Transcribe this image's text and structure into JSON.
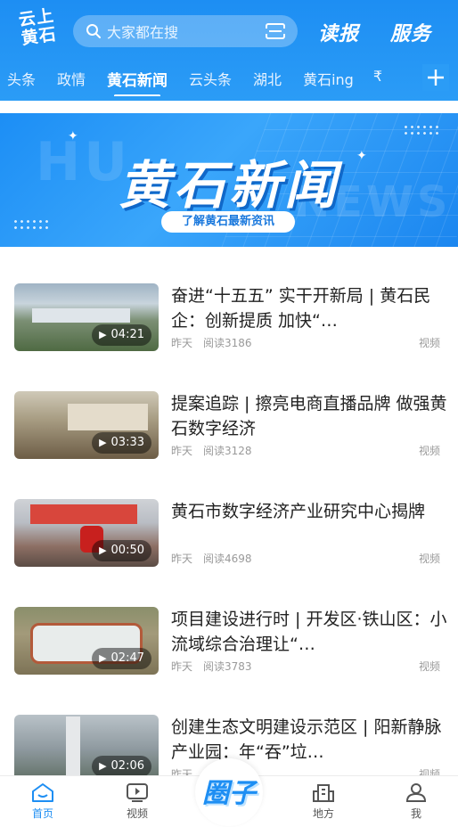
{
  "header": {
    "logo_text": "云上黄石",
    "search_placeholder": "大家都在搜",
    "link_read": "读报",
    "link_service": "服务"
  },
  "tabs": [
    {
      "label": "头条"
    },
    {
      "label": "政情"
    },
    {
      "label": "黄石新闻"
    },
    {
      "label": "云头条"
    },
    {
      "label": "湖北"
    },
    {
      "label": "黄石ing"
    },
    {
      "label": "₹"
    }
  ],
  "banner": {
    "title": "黄石新闻",
    "ghost_left": "HU",
    "ghost_right": "NEWS",
    "pill": "了解黄石最新资讯"
  },
  "news": [
    {
      "title": "奋进“十五五” 实干开新局 | 黄石民企：创新提质 加快“…",
      "duration": "04:21",
      "time": "昨天",
      "reads": "阅读3186",
      "type": "视频"
    },
    {
      "title": "提案追踪 | 擦亮电商直播品牌 做强黄石数字经济",
      "duration": "03:33",
      "time": "昨天",
      "reads": "阅读3128",
      "type": "视频"
    },
    {
      "title": "黄石市数字经济产业研究中心揭牌",
      "duration": "00:50",
      "time": "昨天",
      "reads": "阅读4698",
      "type": "视频"
    },
    {
      "title": "项目建设进行时 | 开发区·铁山区：小流域综合治理让“…",
      "duration": "02:47",
      "time": "昨天",
      "reads": "阅读3783",
      "type": "视频"
    },
    {
      "title": "创建生态文明建设示范区 | 阳新静脉产业园：年“吞”垃…",
      "duration": "02:06",
      "time": "昨天",
      "reads": "",
      "type": "视频"
    }
  ],
  "bottom_nav": {
    "home": "首页",
    "video": "视频",
    "circle": "圈子",
    "local": "地方",
    "me": "我"
  },
  "colors": {
    "brand": "#1d8ef3"
  }
}
